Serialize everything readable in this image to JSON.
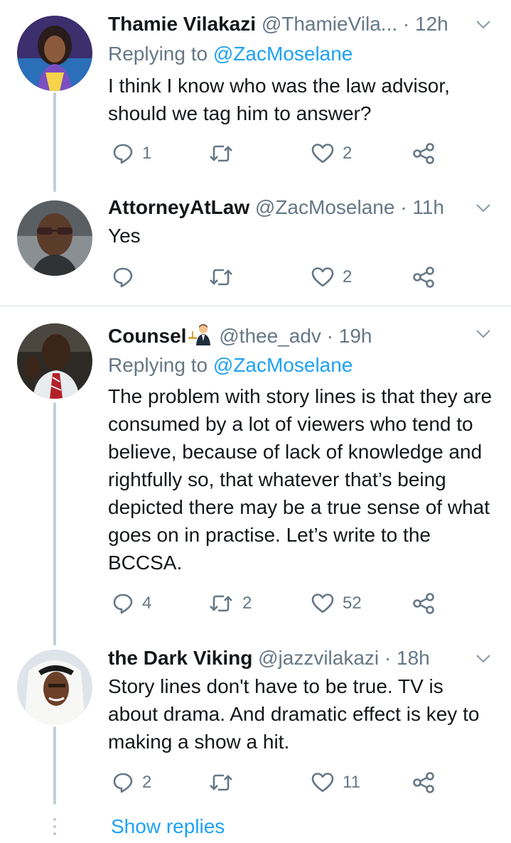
{
  "tweets": [
    {
      "name": "Thamie Vilakazi",
      "handle": "@ThamieVila...",
      "dot": "·",
      "time": "12h",
      "replying_prefix": "Replying to",
      "replying_to": "@ZacMoselane",
      "text": "I think I know who was the law advisor, should we tag him to answer?",
      "replies": "1",
      "retweets": "",
      "likes": "2"
    },
    {
      "name": "AttorneyAtLaw",
      "handle": "@ZacMoselane",
      "dot": "·",
      "time": "11h",
      "text": "Yes",
      "replies": "",
      "retweets": "",
      "likes": "2"
    },
    {
      "name": "Counsel",
      "name_emoji": "⚖️👨‍💼",
      "handle": "@thee_adv",
      "dot": "·",
      "time": "19h",
      "replying_prefix": "Replying to",
      "replying_to": "@ZacMoselane",
      "text": "The problem with story lines is that they are consumed by a lot of viewers who tend to believe, because of lack of knowledge and rightfully so, that whatever that’s being depicted there may be a true sense of what goes on in practise. Let’s write to the BCCSA.",
      "replies": "4",
      "retweets": "2",
      "likes": "52"
    },
    {
      "name": "the Dark Viking",
      "handle": "@jazzvilakazi",
      "dot": "·",
      "time": "18h",
      "text": "Story lines don't have to be true. TV is about drama. And dramatic effect is key to making a show a hit.",
      "replies": "2",
      "retweets": "",
      "likes": "11"
    }
  ],
  "show_replies": "Show replies",
  "icons": {
    "reply": "reply-icon",
    "retweet": "retweet-icon",
    "like": "heart-icon",
    "share": "share-icon",
    "caret": "chevron-down-icon"
  },
  "colors": {
    "accent": "#1da1f2",
    "muted": "#657786",
    "thread_line": "#c4cfd6"
  }
}
